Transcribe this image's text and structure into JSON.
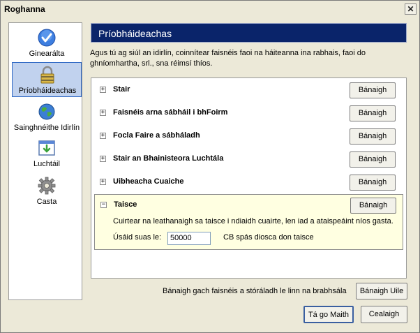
{
  "window": {
    "title": "Roghanna",
    "close_glyph": "✕"
  },
  "sidebar": {
    "items": [
      {
        "label": "Ginearálta",
        "icon": "checkmark-icon"
      },
      {
        "label": "Príobháideachas",
        "icon": "padlock-icon"
      },
      {
        "label": "Sainghnéithe Idirlín",
        "icon": "globe-icon"
      },
      {
        "label": "Luchtáil",
        "icon": "download-icon"
      },
      {
        "label": "Casta",
        "icon": "gear-icon"
      }
    ]
  },
  "panel": {
    "title": "Príobháideachas",
    "description": "Agus tú ag siúl an idirlín, coinnítear faisnéis faoi na háiteanna ina rabhais, faoi do ghníomhartha, srl., sna réimsí thíos."
  },
  "rows": [
    {
      "label": "Stair",
      "button": "Bánaigh",
      "toggle": "+"
    },
    {
      "label": "Faisnéis arna sábháil i bhFoirm",
      "button": "Bánaigh",
      "toggle": "+"
    },
    {
      "label": "Focla Faire a sábháladh",
      "button": "Bánaigh",
      "toggle": "+"
    },
    {
      "label": "Stair an Bhainisteora Luchtála",
      "button": "Bánaigh",
      "toggle": "+"
    },
    {
      "label": "Uibheacha Cuaiche",
      "button": "Bánaigh",
      "toggle": "+"
    }
  ],
  "cache": {
    "label": "Taisce",
    "button": "Bánaigh",
    "toggle": "−",
    "description": "Cuirtear na leathanaigh sa taisce i ndiaidh cuairte, len iad a ataispeáint  níos gasta.",
    "size_label": "Úsáid suas le:",
    "size_value": "50000",
    "size_unit": "CB spás diosca don taisce"
  },
  "footer": {
    "clear_all_text": "Bánaigh gach faisnéis a stóráladh le linn na brabhsála",
    "clear_all_button": "Bánaigh Uile",
    "ok_button": "Tá go Maith",
    "cancel_button": "Cealaigh"
  },
  "colors": {
    "header_bg": "#0a246a",
    "selected_bg": "#c1d2ee",
    "cache_bg": "#ffffe1"
  }
}
